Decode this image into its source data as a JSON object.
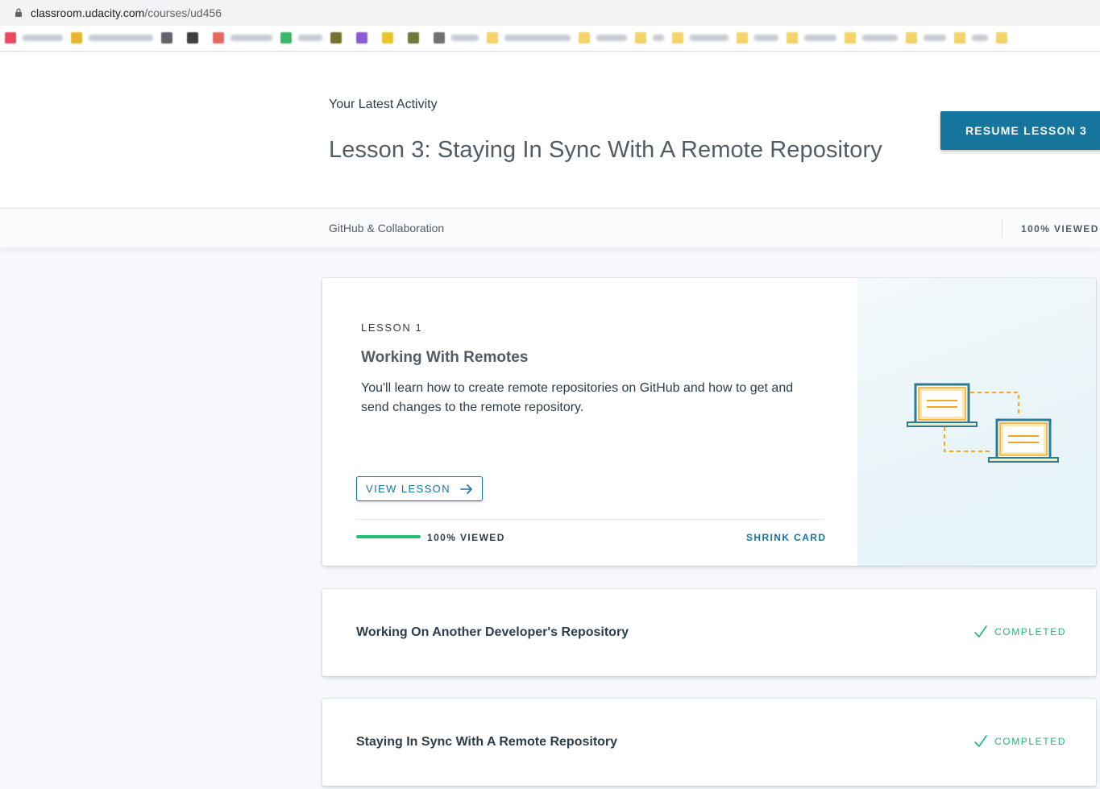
{
  "browser": {
    "url_host": "classroom.udacity.com",
    "url_path": "/courses/ud456",
    "bookmark_colors": [
      "#e64a5e",
      "#e8b62d",
      "#606367",
      "#3c3f42",
      "#e46a5f",
      "#3bb66b",
      "#76722f",
      "#8a5cd4",
      "#e8c52d",
      "#6f7a3a",
      "#707070",
      "#f4d36b",
      "#f4d36b",
      "#f4d36b",
      "#f4d36b",
      "#f4d36b",
      "#f4d36b",
      "#f4d36b",
      "#f4d36b",
      "#f4d36b",
      "#f4d36b"
    ]
  },
  "header": {
    "latest_label": "Your Latest Activity",
    "lesson_title": "Lesson 3: Staying In Sync With A Remote Repository",
    "resume_button": "RESUME LESSON 3"
  },
  "subbar": {
    "course_name": "GitHub & Collaboration",
    "viewed": "100% VIEWED"
  },
  "main_card": {
    "lesson_label": "LESSON 1",
    "lesson_name": "Working With Remotes",
    "description": "You'll learn how to create remote repositories on GitHub and how to get and send changes to the remote repository.",
    "view_button": "VIEW LESSON",
    "progress_fraction": 1.0,
    "progress_text": "100% VIEWED",
    "shrink_label": "SHRINK CARD",
    "accent_color": "#15759d",
    "progress_color": "#1fbf76"
  },
  "lessons": [
    {
      "title": "Working On Another Developer's Repository",
      "status": "COMPLETED"
    },
    {
      "title": "Staying In Sync With A Remote Repository",
      "status": "COMPLETED"
    }
  ]
}
